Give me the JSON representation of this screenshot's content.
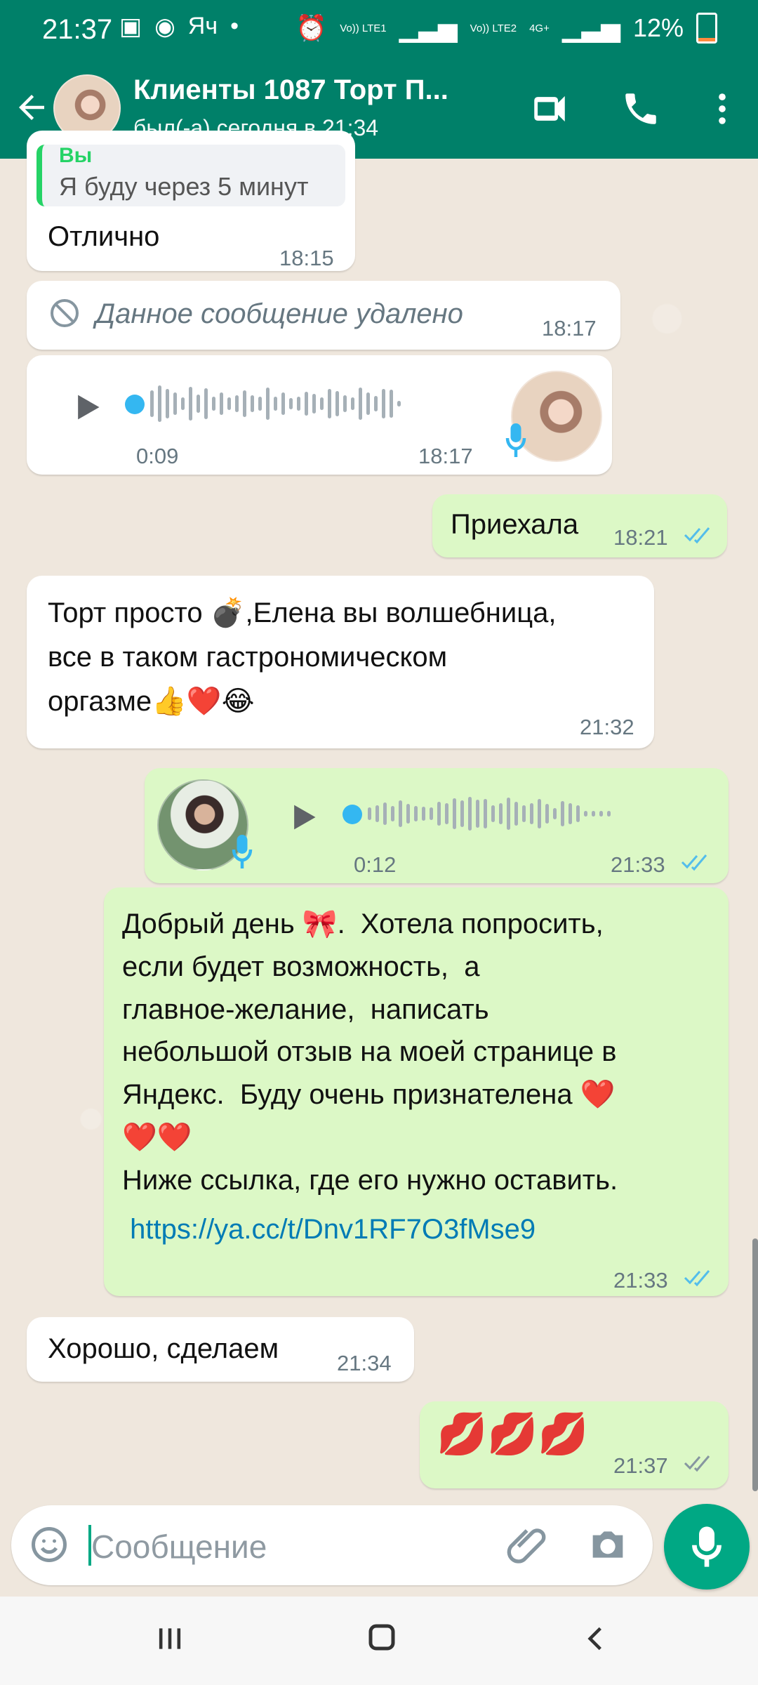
{
  "status": {
    "time": "21:37",
    "left_icons": [
      "image-icon",
      "camera-icon",
      "yandex-icon",
      "dot-icon"
    ],
    "signal_1": "Vo)) LTE1",
    "signal_2": "Vo)) LTE2",
    "network": "4G+",
    "battery_percent": "12%",
    "battery_level": 0.12
  },
  "header": {
    "title": "Клиенты 1087 Торт П...",
    "subtitle": "был(-а) сегодня в 21:34",
    "icons": [
      "back-arrow-icon",
      "video-call-icon",
      "phone-icon",
      "more-options-icon"
    ]
  },
  "messages": {
    "quoted_sender": "Вы",
    "quoted_text": "Я буду через 5 минут",
    "m1_text": "Отлично",
    "m1_time": "18:15",
    "m2_text": "Данное сообщение удалено",
    "m2_time": "18:17",
    "m3_duration": "0:09",
    "m3_time": "18:17",
    "m4_text": "Приехала",
    "m4_time": "18:21",
    "m5_text": "Торт просто 💣,Елена вы волшебница,\nвсе в таком гастрономическом\nоргазме👍❤️😂",
    "m5_time": "21:32",
    "m6_duration": "0:12",
    "m6_time": "21:33",
    "m7_text": "Добрый день 🎀.  Хотела попросить,\nесли будет возможность,  а\nглавное-желание,  написать\nнебольшой отзыв на моей странице в\nЯндекс.  Буду очень признателена ❤️\n❤️❤️\nНиже ссылка, где его нужно оставить.",
    "m7_link": " https://ya.cc/t/Dnv1RF7O3fMse9",
    "m7_time": "21:33",
    "m8_text": "Хорошо, сделаем",
    "m8_time": "21:34",
    "m9_text": "💋💋💋",
    "m9_time": "21:37"
  },
  "composer": {
    "placeholder": "Сообщение",
    "icons": [
      "emoji-icon",
      "attachment-icon",
      "camera-icon",
      "microphone-icon"
    ]
  },
  "navbar": {
    "icons": [
      "recent-apps-icon",
      "home-icon",
      "back-icon"
    ]
  },
  "colors": {
    "header": "#008069",
    "incoming_bubble": "#ffffff",
    "outgoing_bubble": "#dcf8c6",
    "read_ticks": "#53bdeb",
    "sent_ticks": "#8696a0",
    "fab": "#00a884"
  }
}
